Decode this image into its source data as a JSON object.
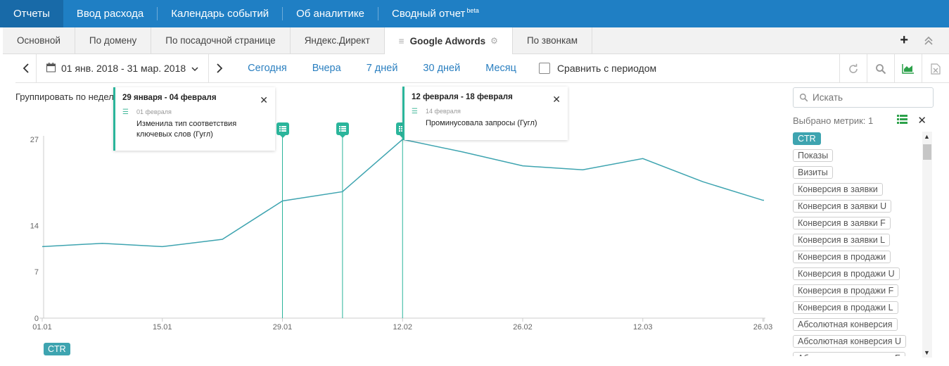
{
  "topnav": {
    "items": [
      {
        "label": "Отчеты"
      },
      {
        "label": "Ввод расхода"
      },
      {
        "label": "Календарь событий"
      },
      {
        "label": "Об аналитике"
      },
      {
        "label": "Сводный отчет"
      }
    ],
    "beta": "beta"
  },
  "tabs": {
    "items": [
      {
        "label": "Основной"
      },
      {
        "label": "По домену"
      },
      {
        "label": "По посадочной странице"
      },
      {
        "label": "Яндекс.Директ"
      },
      {
        "label": "Google Adwords"
      },
      {
        "label": "По звонкам"
      }
    ],
    "plus": "+"
  },
  "filters": {
    "date_range": "01 янв. 2018 - 31 мар. 2018",
    "periods": [
      "Сегодня",
      "Вчера",
      "7 дней",
      "30 дней",
      "Месяц"
    ],
    "compare_label": "Сравнить с периодом"
  },
  "group_label": "Группировать по недел",
  "tooltips": [
    {
      "title": "29 января - 04 февраля",
      "date": "01 февраля",
      "text": "Изменила тип соответствия ключевых слов (Гугл)"
    },
    {
      "title": "12 февраля - 18 февраля",
      "date": "14 февраля",
      "text": "Проминусовала запросы (Гугл)"
    }
  ],
  "legend_chip": "CTR",
  "chart_data": {
    "type": "line",
    "y_ticks": [
      "0",
      "7",
      "14",
      "27"
    ],
    "x_ticks": [
      "01.01",
      "15.01",
      "29.01",
      "12.02",
      "26.02",
      "12.03",
      "26.03"
    ],
    "series": [
      {
        "name": "CTR",
        "x": [
          "01.01",
          "08.01",
          "15.01",
          "22.01",
          "29.01",
          "05.02",
          "12.02",
          "19.02",
          "26.02",
          "05.03",
          "12.03",
          "19.03",
          "26.03",
          "31.03"
        ],
        "values": [
          10.8,
          11.3,
          10.8,
          11.9,
          17.7,
          19.1,
          27.0,
          25.1,
          23.0,
          22.4,
          24.1,
          20.6,
          17.8,
          17.8
        ]
      }
    ],
    "annotation_dates": [
      "29.01",
      "05.02",
      "12.02"
    ],
    "ylim": [
      0,
      27
    ],
    "color": "#3ea4b0"
  },
  "right_panel": {
    "search_placeholder": "Искать",
    "selected_label": "Выбрано метрик: 1",
    "metrics": [
      {
        "label": "CTR",
        "active": true
      },
      {
        "label": "Показы"
      },
      {
        "label": "Визиты"
      },
      {
        "label": "Конверсия в заявки"
      },
      {
        "label": "Конверсия в заявки U"
      },
      {
        "label": "Конверсия в заявки F"
      },
      {
        "label": "Конверсия в заявки L"
      },
      {
        "label": "Конверсия в продажи"
      },
      {
        "label": "Конверсия в продажи U"
      },
      {
        "label": "Конверсия в продажи F"
      },
      {
        "label": "Конверсия в продажи L"
      },
      {
        "label": "Абсолютная конверсия"
      },
      {
        "label": "Абсолютная конверсия U"
      },
      {
        "label": "Абсолютная конверсия F"
      }
    ]
  }
}
